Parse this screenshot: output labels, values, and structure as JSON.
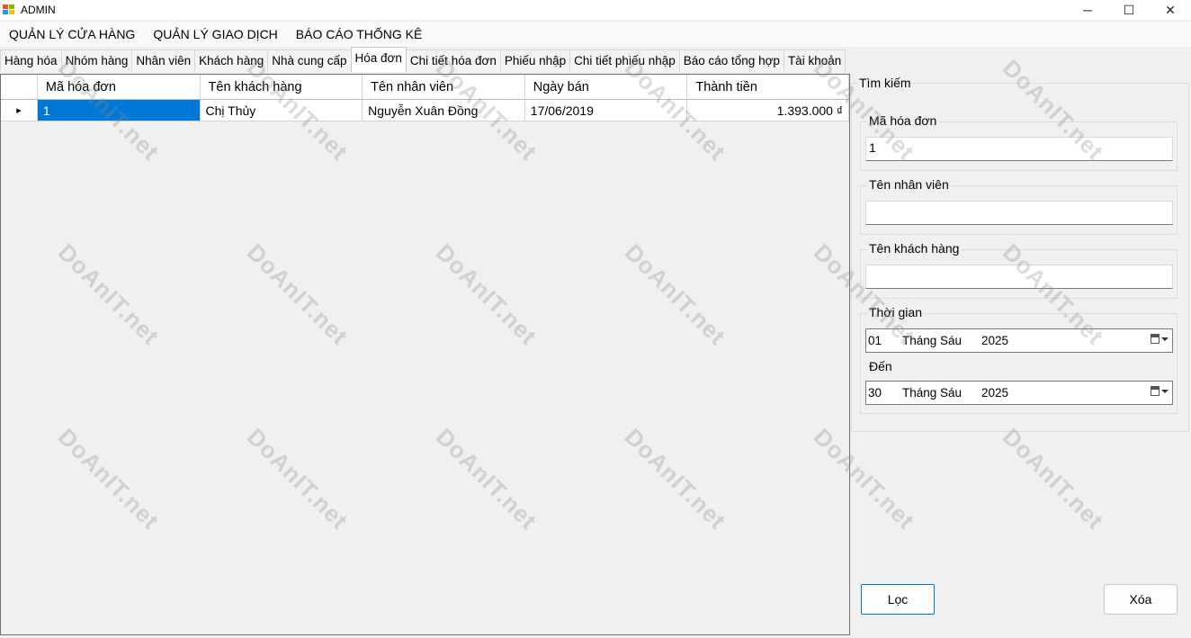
{
  "window": {
    "title": "ADMIN",
    "controls": {
      "minimize": "─",
      "maximize": "☐",
      "close": "✕"
    }
  },
  "menu": [
    {
      "label": "QUẢN LÝ CỬA HÀNG"
    },
    {
      "label": "QUẢN LÝ GIAO DỊCH"
    },
    {
      "label": "BÁO CÁO THỐNG KÊ"
    }
  ],
  "tabs": [
    {
      "label": "Hàng hóa"
    },
    {
      "label": "Nhóm hàng"
    },
    {
      "label": "Nhân viên"
    },
    {
      "label": "Khách hàng"
    },
    {
      "label": "Nhà cung cấp"
    },
    {
      "label": "Hóa đơn",
      "active": true
    },
    {
      "label": "Chi tiết hóa đơn"
    },
    {
      "label": "Phiếu nhập"
    },
    {
      "label": "Chi tiết phiếu nhập"
    },
    {
      "label": "Báo cáo tổng hợp"
    },
    {
      "label": "Tài khoản"
    }
  ],
  "grid": {
    "columns": [
      "Mã hóa đơn",
      "Tên khách hàng",
      "Tên nhân viên",
      "Ngày bán",
      "Thành tiền"
    ],
    "rows": [
      [
        "1",
        "Chị Thủy",
        "Nguyễn Xuân Đồng",
        "17/06/2019",
        "1.393.000 ₫"
      ]
    ],
    "current_row_marker": "▸"
  },
  "search": {
    "title": "Tìm kiếm",
    "invoice_id": {
      "label": "Mã hóa đơn",
      "value": "1"
    },
    "employee": {
      "label": "Tên nhân viên",
      "value": ""
    },
    "customer": {
      "label": "Tên khách hàng",
      "value": ""
    },
    "time": {
      "label": "Thời gian",
      "from": {
        "day": "01",
        "month": "Tháng Sáu",
        "year": "2025"
      },
      "to_label": "Đến",
      "to": {
        "day": "30",
        "month": "Tháng Sáu",
        "year": "2025"
      }
    },
    "filter_button": "Lọc",
    "delete_button": "Xóa"
  },
  "watermark": {
    "text": "DoAnIT.net"
  }
}
